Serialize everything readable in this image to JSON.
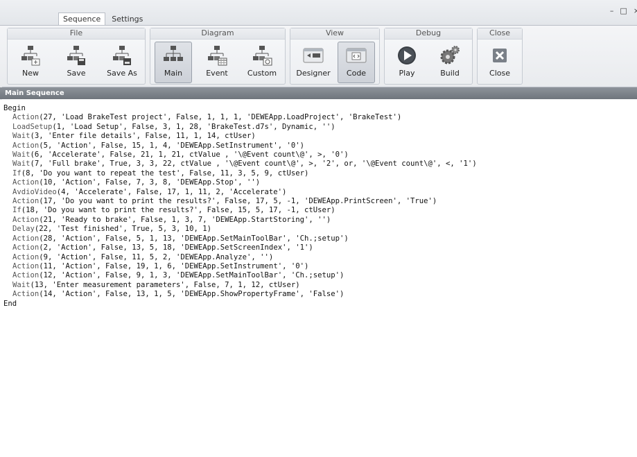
{
  "tabs": [
    "Sequence",
    "Settings"
  ],
  "window_controls": [
    "–",
    "□",
    "×"
  ],
  "ribbon": {
    "groups": [
      {
        "title": "File",
        "buttons": [
          "New",
          "Save",
          "Save As"
        ]
      },
      {
        "title": "Diagram",
        "buttons": [
          "Main",
          "Event",
          "Custom"
        ]
      },
      {
        "title": "View",
        "buttons": [
          "Designer",
          "Code"
        ]
      },
      {
        "title": "Debug",
        "buttons": [
          "Play",
          "Build"
        ]
      },
      {
        "title": "Close",
        "buttons": [
          "Close"
        ]
      }
    ],
    "pressed": [
      "Main",
      "Code"
    ]
  },
  "section_header": "Main Sequence",
  "code": {
    "begin": "Begin",
    "end": "End",
    "lines": [
      {
        "kw": "Action",
        "args": "(27, 'Load BrakeTest project', False, 1, 1, 1, 'DEWEApp.LoadProject', 'BrakeTest')"
      },
      {
        "kw": "LoadSetup",
        "args": "(1, 'Load Setup', False, 3, 1, 28, 'BrakeTest.d7s', Dynamic, '')"
      },
      {
        "kw": "Wait",
        "args": "(3, 'Enter file details', False, 11, 1, 14, ctUser)"
      },
      {
        "kw": "Action",
        "args": "(5, 'Action', False, 15, 1, 4, 'DEWEApp.SetInstrument', '0')"
      },
      {
        "kw": "Wait",
        "args": "(6, 'Accelerate', False, 21, 1, 21, ctValue , '\\@Event count\\@', >, '0')"
      },
      {
        "kw": "Wait",
        "args": "(7, 'Full brake', True, 3, 3, 22, ctValue , '\\@Event count\\@', >, '2', or, '\\@Event count\\@', <, '1')"
      },
      {
        "kw": "If",
        "args": "(8, 'Do you want to repeat the test', False, 11, 3, 5, 9, ctUser)"
      },
      {
        "kw": "Action",
        "args": "(10, 'Action', False, 7, 3, 8, 'DEWEApp.Stop', '')"
      },
      {
        "kw": "AvdioVideo",
        "args": "(4, 'Accelerate', False, 17, 1, 11, 2, 'Accelerate')"
      },
      {
        "kw": "Action",
        "args": "(17, 'Do you want to print the results?', False, 17, 5, -1, 'DEWEApp.PrintScreen', 'True')"
      },
      {
        "kw": "If",
        "args": "(18, 'Do you want to print the results?', False, 15, 5, 17, -1, ctUser)"
      },
      {
        "kw": "Action",
        "args": "(21, 'Ready to brake', False, 1, 3, 7, 'DEWEApp.StartStoring', '')"
      },
      {
        "kw": "Delay",
        "args": "(22, 'Test finished', True, 5, 3, 10, 1)"
      },
      {
        "kw": "Action",
        "args": "(28, 'Action', False, 5, 1, 13, 'DEWEApp.SetMainToolBar', 'Ch.;setup')"
      },
      {
        "kw": "Action",
        "args": "(2, 'Action', False, 13, 5, 18, 'DEWEApp.SetScreenIndex', '1')"
      },
      {
        "kw": "Action",
        "args": "(9, 'Action', False, 11, 5, 2, 'DEWEApp.Analyze', '')"
      },
      {
        "kw": "Action",
        "args": "(11, 'Action', False, 19, 1, 6, 'DEWEApp.SetInstrument', '0')"
      },
      {
        "kw": "Action",
        "args": "(12, 'Action', False, 9, 1, 3, 'DEWEApp.SetMainToolBar', 'Ch.;setup')"
      },
      {
        "kw": "Wait",
        "args": "(13, 'Enter measurement parameters', False, 7, 1, 12, ctUser)"
      },
      {
        "kw": "Action",
        "args": "(14, 'Action', False, 13, 1, 5, 'DEWEApp.ShowPropertyFrame', 'False')"
      }
    ]
  }
}
